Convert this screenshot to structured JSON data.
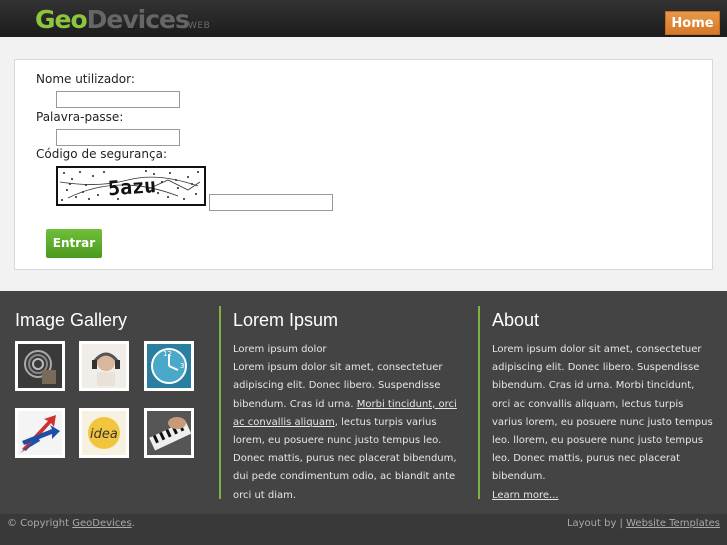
{
  "header": {
    "logo_part1": "Geo",
    "logo_part2": "Devices",
    "logo_suffix": "WEB",
    "nav_home": "Home"
  },
  "form": {
    "username_label": "Nome utilizador:",
    "password_label": "Palavra-passe:",
    "captcha_label": "Código de segurança:",
    "captcha_text": "5azu",
    "submit_label": "Entrar"
  },
  "gallery": {
    "title": "Image Gallery",
    "items": [
      "fingerprint-photo",
      "headphones-photo",
      "clock-photo",
      "arrows-photo",
      "idea-photo",
      "piano-photo"
    ]
  },
  "lorem": {
    "title": "Lorem Ipsum",
    "line1": "Lorem ipsum dolor",
    "text_before_link": "Lorem ipsum dolor sit amet, consectetuer adipiscing elit. Donec libero. Suspendisse bibendum. Cras id urna. ",
    "link": "Morbi tincidunt, orci ac convallis aliquam",
    "text_after_link": ", lectus turpis varius lorem, eu posuere nunc justo tempus leo. Donec mattis, purus nec placerat bibendum, dui pede condimentum odio, ac blandit ante orci ut diam."
  },
  "about": {
    "title": "About",
    "text": "Lorem ipsum dolor sit amet, consectetuer adipiscing elit. Donec libero. Suspendisse bibendum. Cras id urna. Morbi tincidunt, orci ac convallis aliquam, lectus turpis varius lorem, eu posuere nunc justo tempus leo. llorem, eu posuere nunc justo tempus leo. Donec mattis, purus nec placerat bibendum.",
    "learn_more": "Learn more..."
  },
  "bottom": {
    "copyright_prefix": "© Copyright ",
    "copyright_link": "GeoDevices",
    "copyright_suffix": ".",
    "layout_prefix": "Layout by | ",
    "layout_link": "Website Templates"
  },
  "colors": {
    "accent_green": "#8cc63f",
    "nav_orange": "#d7782a",
    "divider_green": "#7cb342"
  }
}
